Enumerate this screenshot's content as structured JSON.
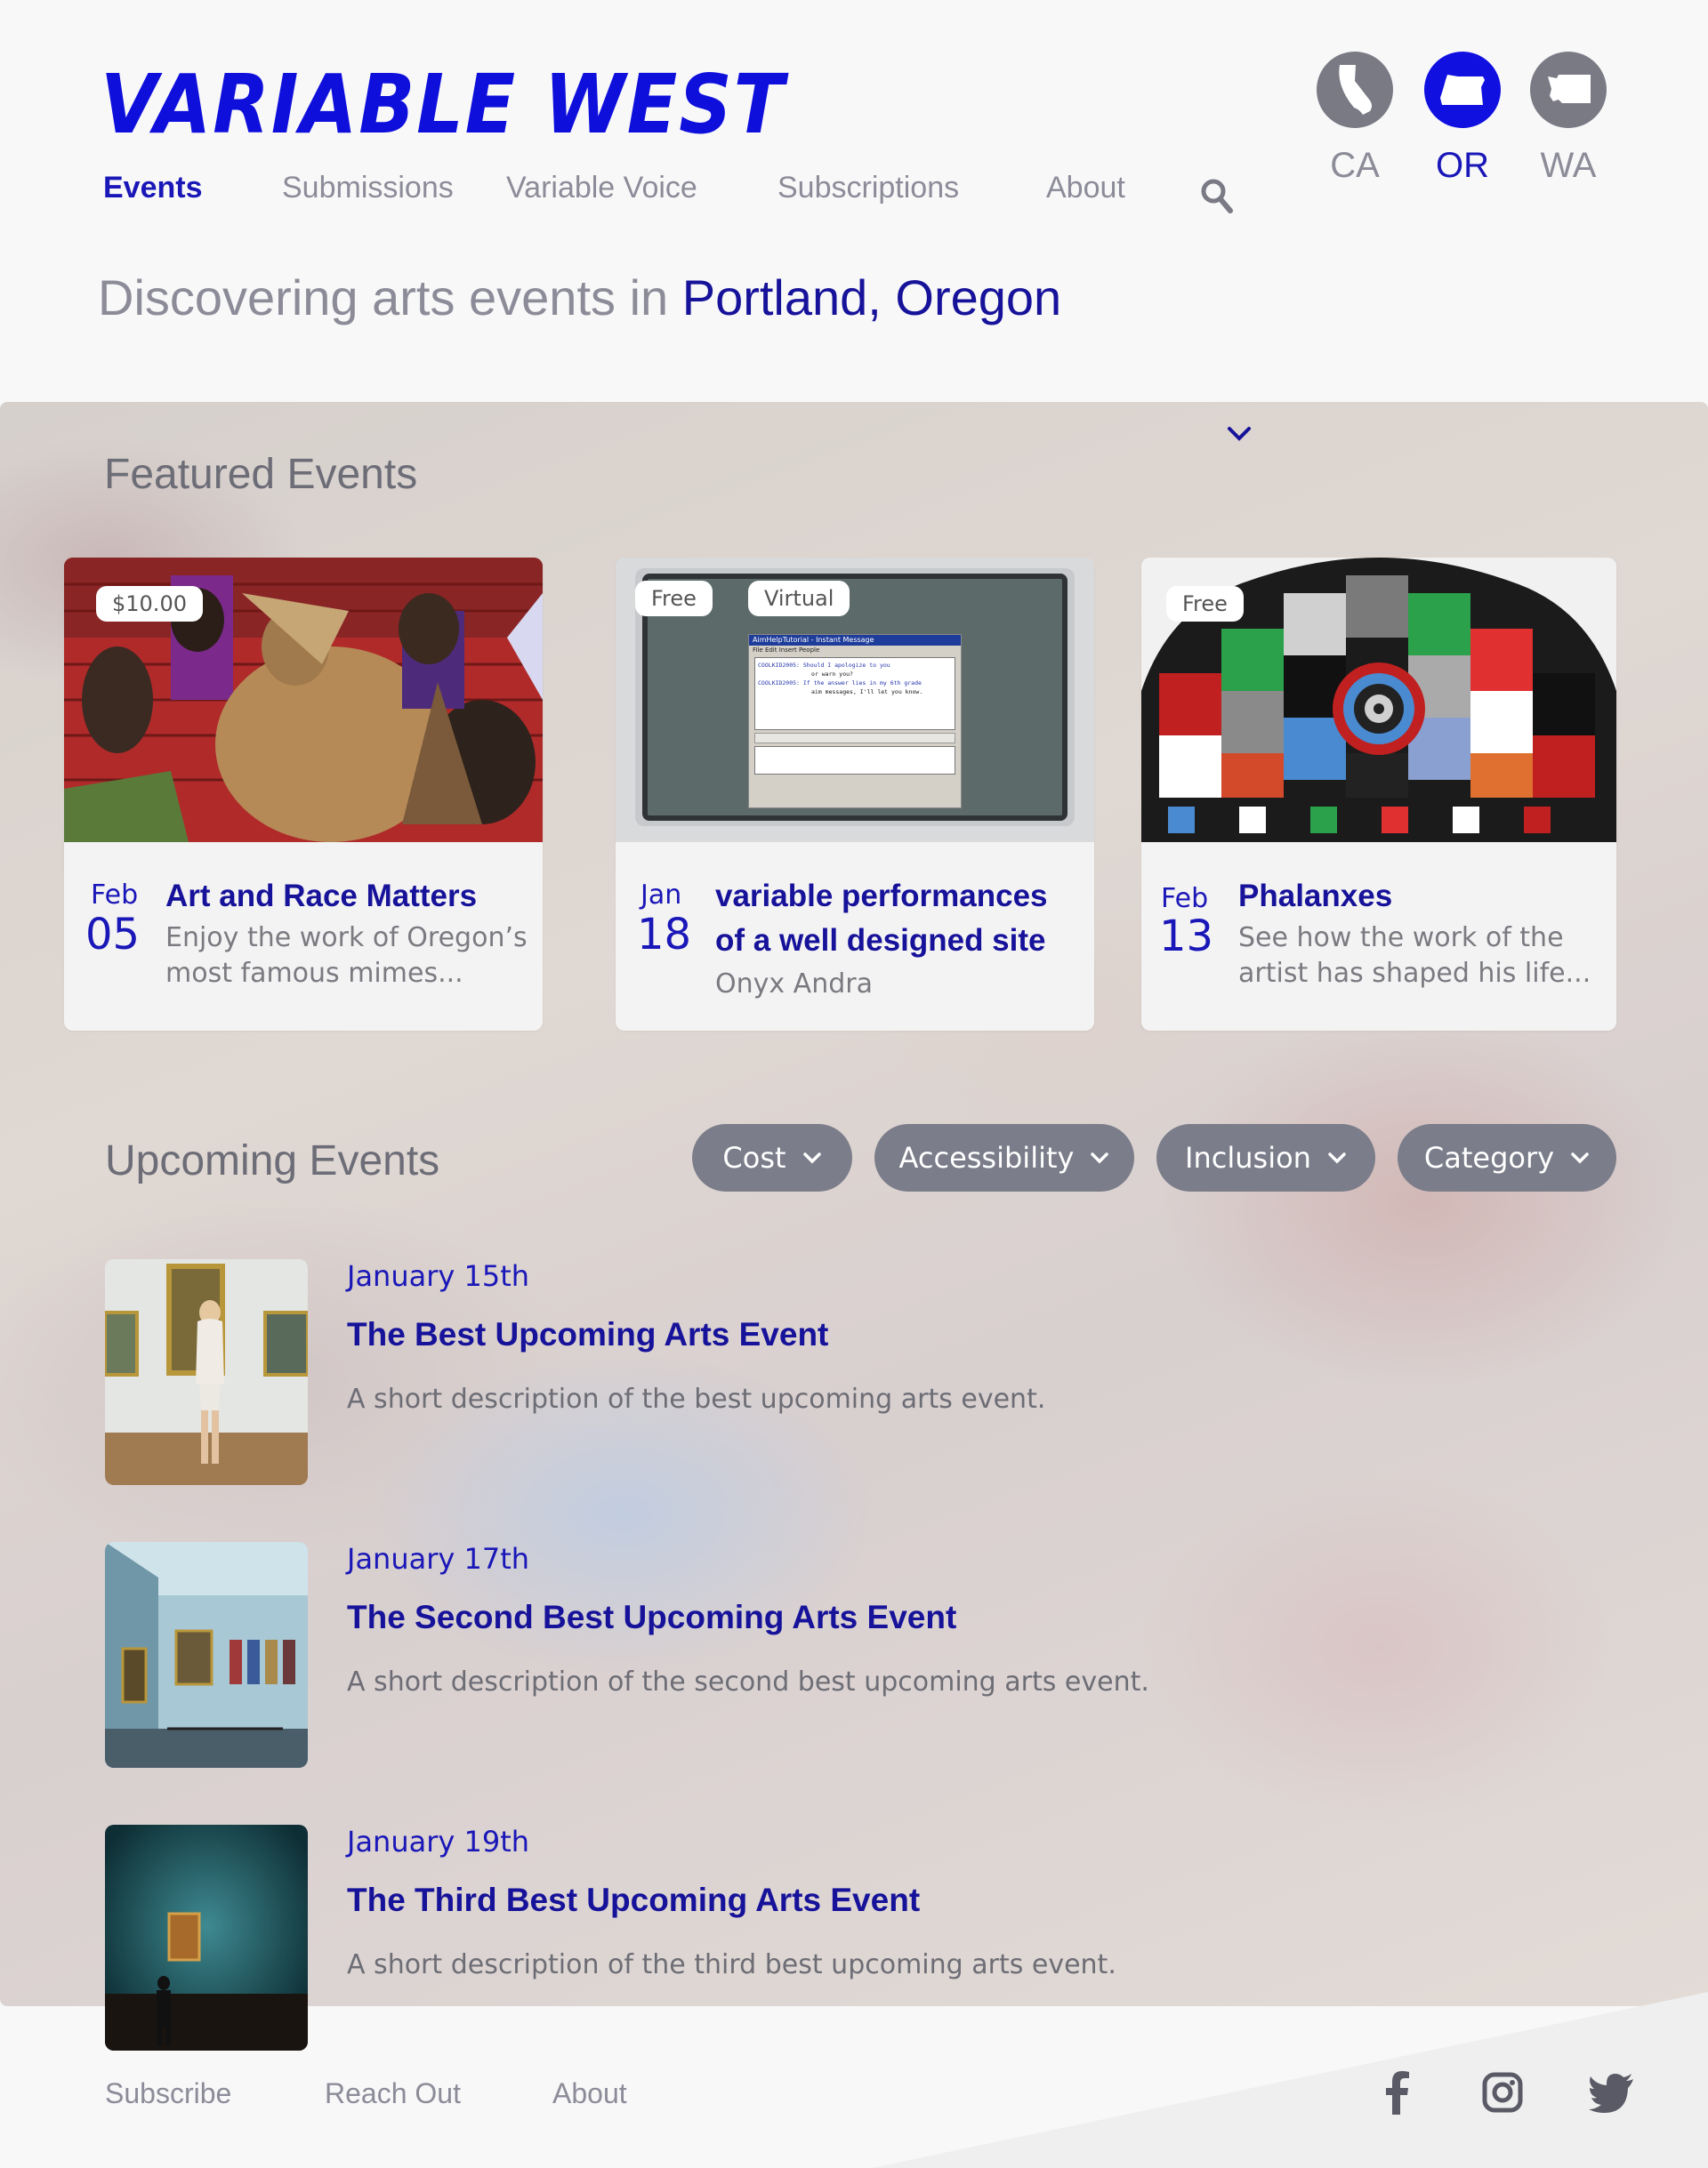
{
  "brand": {
    "logo": "VARIABLE WEST",
    "accent": "#1010e0",
    "link_color": "#16129a"
  },
  "nav": {
    "items": [
      {
        "label": "Events",
        "active": true
      },
      {
        "label": "Submissions",
        "active": false
      },
      {
        "label": "Variable Voice",
        "active": false
      },
      {
        "label": "Subscriptions",
        "active": false
      },
      {
        "label": "About",
        "active": false
      }
    ]
  },
  "states": [
    {
      "code": "CA",
      "icon": "california-icon",
      "active": false
    },
    {
      "code": "OR",
      "icon": "oregon-icon",
      "active": true
    },
    {
      "code": "WA",
      "icon": "washington-icon",
      "active": false
    }
  ],
  "tagline": {
    "prefix": "Discovering arts events in",
    "location": "Portland, Oregon"
  },
  "featured": {
    "title": "Featured Events",
    "cards": [
      {
        "badges": [
          "$10.00"
        ],
        "month": "Feb",
        "day": "05",
        "title_lines": [
          "Art and Race Matters"
        ],
        "desc_lines": [
          "Enjoy the work of Oregon’s",
          "most famous mimes..."
        ]
      },
      {
        "badges": [
          "Free",
          "Virtual"
        ],
        "month": "Jan",
        "day": "18",
        "title_lines": [
          "variable performances",
          "of a well designed site"
        ],
        "desc_lines": [
          "Onyx Andra"
        ]
      },
      {
        "badges": [
          "Free"
        ],
        "month": "Feb",
        "day": "13",
        "title_lines": [
          "Phalanxes"
        ],
        "desc_lines": [
          "See how the work of the",
          "artist has shaped his life..."
        ]
      }
    ],
    "card2_screen": {
      "window_title": "AimHelpTutorial - Instant Message",
      "menu": "File Edit Insert People",
      "lines": [
        "COOLKID2005: Should I apologize to you",
        "or warn you?",
        "COOLKID2005: If the answer lies in my 6th grade",
        "aim messages, I'll let you know."
      ]
    }
  },
  "upcoming": {
    "title": "Upcoming Events",
    "filters": [
      "Cost",
      "Accessibility",
      "Inclusion",
      "Category"
    ],
    "events": [
      {
        "date": "January 15th",
        "title": "The Best Upcoming Arts Event",
        "desc": "A short description of the best upcoming arts event."
      },
      {
        "date": "January 17th",
        "title": "The Second Best Upcoming Arts Event",
        "desc": "A short description of the second best upcoming arts event."
      },
      {
        "date": "January 19th",
        "title": "The Third Best Upcoming Arts Event",
        "desc": "A short description of the third best upcoming arts event."
      }
    ]
  },
  "footer": {
    "links": [
      "Subscribe",
      "Reach Out",
      "About"
    ],
    "social": [
      "facebook-icon",
      "instagram-icon",
      "twitter-icon"
    ]
  }
}
